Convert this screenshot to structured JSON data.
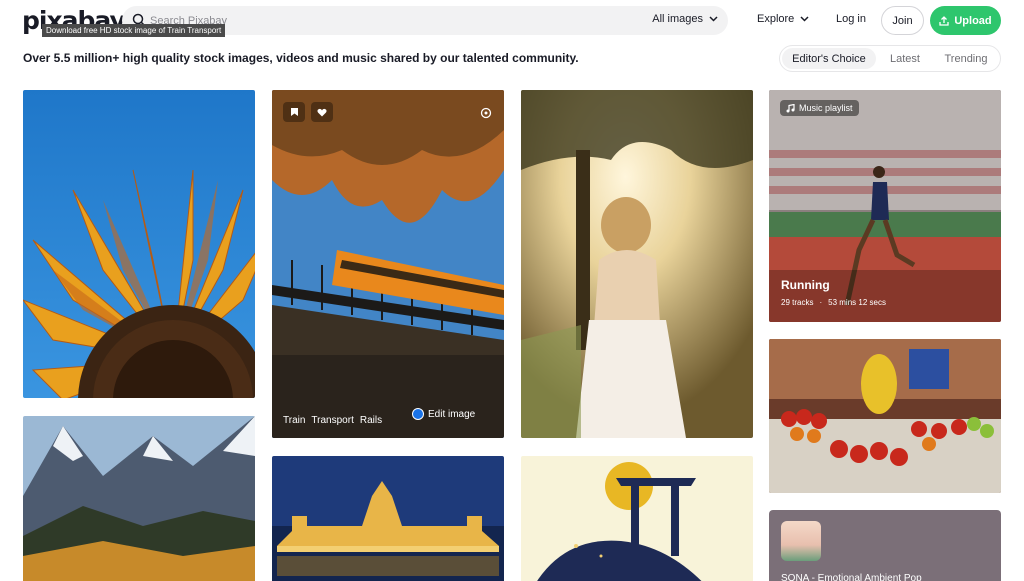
{
  "header": {
    "logo": "pixabay",
    "search_placeholder": "Search Pixabay",
    "tooltip": "Download free HD stock image of Train Transport",
    "media_filter": "All images",
    "nav_explore": "Explore",
    "nav_login": "Log in",
    "join_label": "Join",
    "upload_label": "Upload"
  },
  "subheader": {
    "tagline": "Over 5.5 million+ high quality stock images, videos and music shared by our talented community.",
    "tabs": [
      {
        "label": "Editor's Choice"
      },
      {
        "label": "Latest"
      },
      {
        "label": "Trending"
      }
    ]
  },
  "tiles": {
    "train": {
      "tags": [
        "Train",
        "Transport",
        "Rails"
      ],
      "edit_label": "Edit image"
    },
    "playlist": {
      "badge": "Music playlist",
      "title": "Running",
      "tracks": "29 tracks",
      "duration": "53 mins 12 secs"
    },
    "music_card": {
      "title": "SONA - Emotional Ambient Pop"
    }
  },
  "colors": {
    "accent": "#2ec66d",
    "text": "#191b26"
  }
}
